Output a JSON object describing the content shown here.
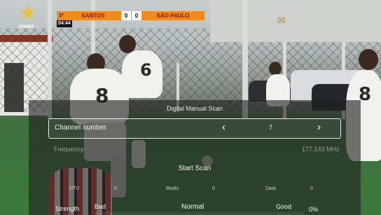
{
  "broadcast": {
    "channel_logo_text": "SOMBR",
    "scoreboard": {
      "half": "1º",
      "home_team": "SANTOS",
      "home_score": "0",
      "away_score": "0",
      "away_team": "SÃO PAULO",
      "clock": "04:44"
    },
    "colors": {
      "scoreboard_accent": "#f08a1c"
    }
  },
  "menu": {
    "title": "Digital Manual Scan",
    "channel_number": {
      "label": "Channel number",
      "value": "7",
      "left_arrow": "‹",
      "right_arrow": "›"
    },
    "frequency": {
      "label": "Frequency",
      "value": "177.143 MHz"
    },
    "start_scan_label": "Start Scan",
    "counts": {
      "dtv_label": "DTV",
      "dtv_value": "0",
      "radio_label": "Radio",
      "radio_value": "0",
      "data_label": "Data",
      "data_value": "0"
    },
    "strength": {
      "label": "Strength",
      "bad_label": "Bad",
      "normal_label": "Normal",
      "good_label": "Good",
      "percent_text": "0%",
      "level_fraction": 0.0,
      "bar_color": "#3cd46a"
    }
  }
}
